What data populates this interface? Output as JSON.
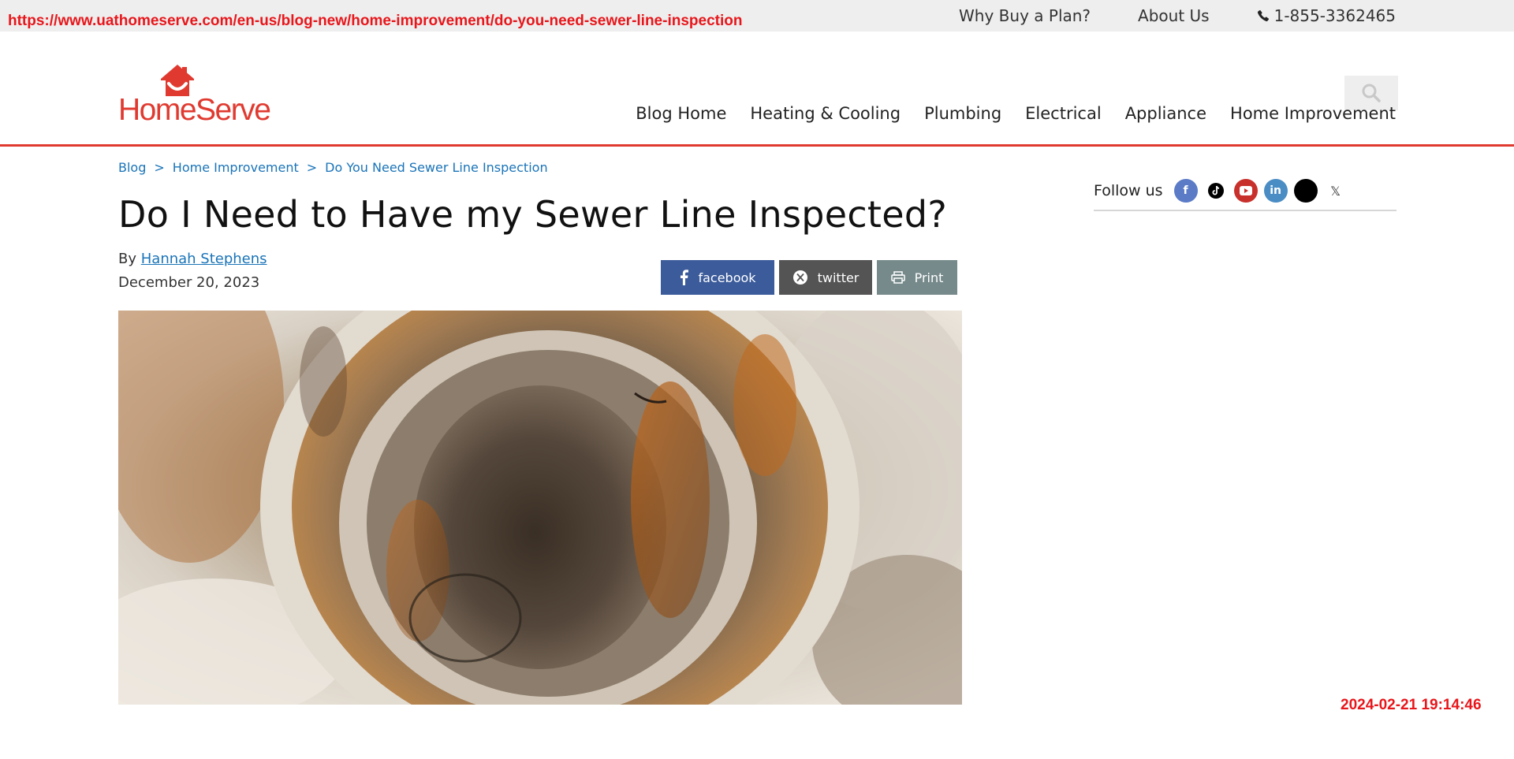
{
  "overlay": {
    "url": "https://www.uathomeserve.com/en-us/blog-new/home-improvement/do-you-need-sewer-line-inspection",
    "timestamp": "2024-02-21 19:14:46"
  },
  "topbar": {
    "links": [
      "Why Buy a Plan?",
      "About Us"
    ],
    "phone": "1-855-3362465"
  },
  "brand": {
    "name": "HomeServe",
    "color": "#e03a30"
  },
  "nav": {
    "items": [
      "Blog Home",
      "Heating & Cooling",
      "Plumbing",
      "Electrical",
      "Appliance",
      "Home Improvement"
    ]
  },
  "breadcrumb": {
    "items": [
      "Blog",
      "Home Improvement",
      "Do You Need Sewer Line Inspection"
    ],
    "separator": ">"
  },
  "article": {
    "title": "Do I Need to Have my Sewer Line Inspected?",
    "by_prefix": "By",
    "author": "Hannah Stephens",
    "date": "December 20, 2023"
  },
  "share": {
    "facebook": "facebook",
    "twitter": "twitter",
    "print": "Print"
  },
  "sidebar": {
    "follow_label": "Follow us",
    "social_icons": [
      "facebook-icon",
      "tiktok-icon",
      "youtube-icon",
      "linkedin-icon",
      "black-circle-icon",
      "x-icon"
    ],
    "x_glyph": "𝕏"
  },
  "colors": {
    "link": "#1a74b8",
    "accent": "#e03a30",
    "facebook": "#3b5b9a",
    "twitter": "#545454",
    "print": "#778a8b"
  }
}
